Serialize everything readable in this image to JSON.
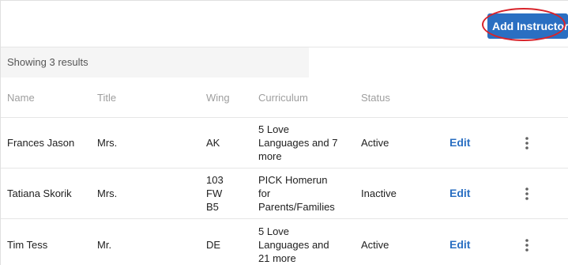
{
  "toolbar": {
    "add_instructor_label": "Add Instructor",
    "accent_color": "#2a6fc2",
    "highlight_color": "#d8232a"
  },
  "results": {
    "summary": "Showing 3 results"
  },
  "table": {
    "headers": {
      "name": "Name",
      "title": "Title",
      "wing": "Wing",
      "curriculum": "Curriculum",
      "status": "Status"
    },
    "rows": [
      {
        "name": "Frances Jason",
        "title": "Mrs.",
        "wing": [
          "AK"
        ],
        "curriculum": [
          "5 Love",
          "Languages and 7",
          "more"
        ],
        "status": "Active",
        "edit_label": "Edit",
        "more_icon": "more-vertical-icon"
      },
      {
        "name": "Tatiana Skorik",
        "title": "Mrs.",
        "wing": [
          "103",
          "FW",
          "B5"
        ],
        "curriculum": [
          "PICK Homerun",
          "for",
          "Parents/Families"
        ],
        "status": "Inactive",
        "edit_label": "Edit",
        "more_icon": "more-vertical-icon"
      },
      {
        "name": "Tim Tess",
        "title": "Mr.",
        "wing": [
          "DE"
        ],
        "curriculum": [
          "5 Love",
          "Languages and",
          "21 more"
        ],
        "status": "Active",
        "edit_label": "Edit",
        "more_icon": "more-vertical-icon"
      }
    ]
  }
}
